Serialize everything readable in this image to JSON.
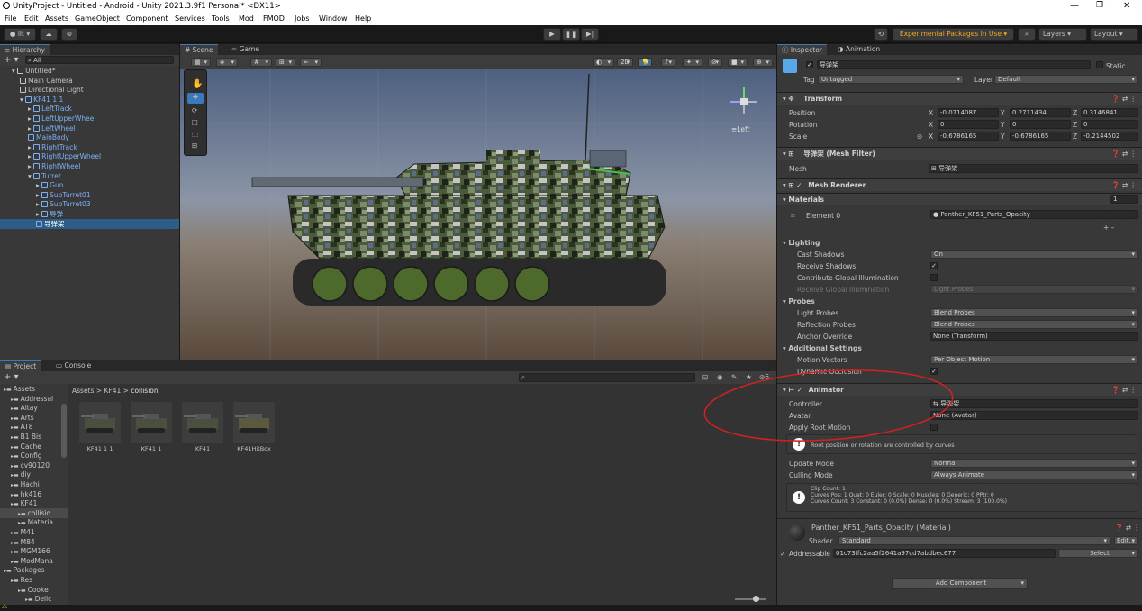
{
  "titlebar": {
    "title": "UnityProject - Untitled - Android - Unity 2021.3.9f1 Personal* <DX11>"
  },
  "menu": [
    "File",
    "Edit",
    "Assets",
    "GameObject",
    "Component",
    "Services",
    "Tools",
    "Mod",
    "FMOD",
    "Jobs",
    "Window",
    "Help"
  ],
  "toolbar": {
    "account_label": "lit ▾",
    "experimental": "Experimental Packages In Use ▾",
    "layers": "Layers",
    "layout": "Layout"
  },
  "hierarchy": {
    "tab": "Hierarchy",
    "search_placeholder": "All",
    "items": [
      {
        "label": "Untitled*",
        "indent": 0,
        "type": "scene"
      },
      {
        "label": "Main Camera",
        "indent": 1,
        "type": "obj"
      },
      {
        "label": "Directional Light",
        "indent": 1,
        "type": "obj"
      },
      {
        "label": "KF41 1 1",
        "indent": 1,
        "type": "prefab"
      },
      {
        "label": "LeftTrack",
        "indent": 2,
        "type": "prefab"
      },
      {
        "label": "LeftUpperWheel",
        "indent": 2,
        "type": "prefab"
      },
      {
        "label": "LeftWheel",
        "indent": 2,
        "type": "prefab"
      },
      {
        "label": "MainBody",
        "indent": 2,
        "type": "prefab"
      },
      {
        "label": "RightTrack",
        "indent": 2,
        "type": "prefab"
      },
      {
        "label": "RightUpperWheel",
        "indent": 2,
        "type": "prefab"
      },
      {
        "label": "RightWheel",
        "indent": 2,
        "type": "prefab"
      },
      {
        "label": "Turret",
        "indent": 2,
        "type": "prefab"
      },
      {
        "label": "Gun",
        "indent": 3,
        "type": "prefab"
      },
      {
        "label": "SubTurret01",
        "indent": 3,
        "type": "prefab"
      },
      {
        "label": "SubTurret03",
        "indent": 3,
        "type": "prefab"
      },
      {
        "label": "导弹",
        "indent": 3,
        "type": "prefab"
      },
      {
        "label": "导弹架",
        "indent": 3,
        "type": "prefab",
        "selected": true
      }
    ]
  },
  "scene": {
    "tab_scene": "Scene",
    "tab_game": "Game",
    "mode_2d": "2D",
    "gizmo_label": "≡Left"
  },
  "project": {
    "tab_project": "Project",
    "tab_console": "Console",
    "breadcrumb": [
      "Assets",
      "KF41",
      "collision"
    ],
    "tree": [
      "Assets",
      "Addressal",
      "Altay",
      "Arts",
      "AT8",
      "B1 Bis",
      "Cache",
      "Config",
      "cv90120",
      "diy",
      "Hachi",
      "hk416",
      "KF41",
      "collisio",
      "Materia",
      "M41",
      "M84",
      "MGM166",
      "ModMana",
      "Packages",
      "Res",
      "Cooke",
      "Delic"
    ],
    "assets": [
      "KF41 1 1",
      "KF41 1",
      "KF41",
      "KF41HitBox"
    ],
    "count_label": "6"
  },
  "inspector": {
    "tab_inspector": "Inspector",
    "tab_animation": "Animation",
    "object_name": "导弹架",
    "static_label": "Static",
    "tag_label": "Tag",
    "tag_value": "Untagged",
    "layer_label": "Layer",
    "layer_value": "Default",
    "transform": {
      "title": "Transform",
      "position": {
        "label": "Position",
        "x": "-0.0714087",
        "y": "0.2711434",
        "z": "0.3146841"
      },
      "rotation": {
        "label": "Rotation",
        "x": "0",
        "y": "0",
        "z": "0"
      },
      "scale": {
        "label": "Scale",
        "x": "-0.6786165",
        "y": "-0.6786165",
        "z": "-0.2144502"
      }
    },
    "mesh_filter": {
      "title": "导弹架 (Mesh Filter)",
      "mesh_label": "Mesh",
      "mesh_value": "导弹架"
    },
    "mesh_renderer": {
      "title": "Mesh Renderer",
      "materials_label": "Materials",
      "materials_count": "1",
      "element0_label": "Element 0",
      "element0_value": "Panther_KF51_Parts_Opacity",
      "lighting": "Lighting",
      "cast_shadows_label": "Cast Shadows",
      "cast_shadows_value": "On",
      "receive_shadows_label": "Receive Shadows",
      "contribute_gi_label": "Contribute Global Illumination",
      "receive_gi_label": "Receive Global Illumination",
      "receive_gi_value": "Light Probes",
      "probes": "Probes",
      "light_probes_label": "Light Probes",
      "light_probes_value": "Blend Probes",
      "reflection_probes_label": "Reflection Probes",
      "reflection_probes_value": "Blend Probes",
      "anchor_override_label": "Anchor Override",
      "anchor_override_value": "None (Transform)",
      "additional": "Additional Settings",
      "motion_vectors_label": "Motion Vectors",
      "motion_vectors_value": "Per Object Motion",
      "dynamic_occlusion_label": "Dynamic Occlusion"
    },
    "animator": {
      "title": "Animator",
      "controller_label": "Controller",
      "controller_value": "导弹架",
      "avatar_label": "Avatar",
      "avatar_value": "None (Avatar)",
      "root_motion_label": "Apply Root Motion",
      "root_help": "Root position or rotation are controlled by curves",
      "update_mode_label": "Update Mode",
      "update_mode_value": "Normal",
      "culling_mode_label": "Culling Mode",
      "culling_mode_value": "Always Animate",
      "info_line1": "Clip Count: 1",
      "info_line2": "Curves Pos: 1 Quat: 0 Euler: 0 Scale: 0 Muscles: 0 Generic: 0 PPtr: 0",
      "info_line3": "Curves Count: 3 Constant: 0 (0.0%) Dense: 0 (0.0%) Stream: 3 (100.0%)"
    },
    "material": {
      "title": "Panther_KF51_Parts_Opacity (Material)",
      "shader_label": "Shader",
      "shader_value": "Standard",
      "edit_label": "Edit...",
      "addressable_label": "Addressable",
      "addressable_value": "01c73ffc2aa5f2641a97cd7abdbec677",
      "select_label": "Select"
    },
    "add_component": "Add Component"
  },
  "colors": {
    "accent": "#3a79bb",
    "selection": "#2c5d87",
    "annotation": "#d42020"
  }
}
